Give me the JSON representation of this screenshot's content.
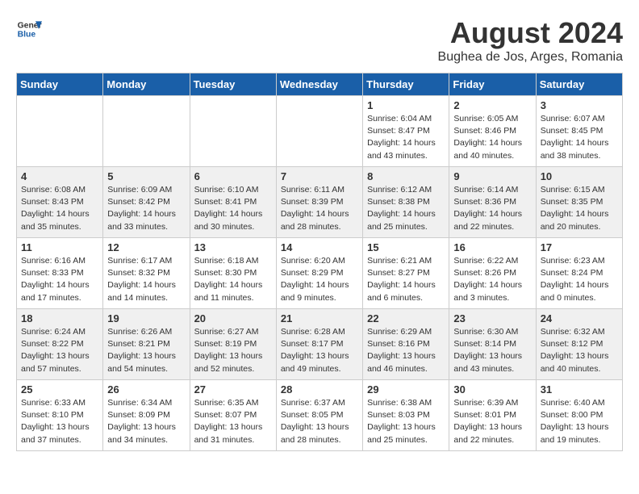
{
  "header": {
    "logo_line1": "General",
    "logo_line2": "Blue",
    "month_year": "August 2024",
    "location": "Bughea de Jos, Arges, Romania"
  },
  "weekdays": [
    "Sunday",
    "Monday",
    "Tuesday",
    "Wednesday",
    "Thursday",
    "Friday",
    "Saturday"
  ],
  "weeks": [
    [
      {
        "day": "",
        "info": ""
      },
      {
        "day": "",
        "info": ""
      },
      {
        "day": "",
        "info": ""
      },
      {
        "day": "",
        "info": ""
      },
      {
        "day": "1",
        "info": "Sunrise: 6:04 AM\nSunset: 8:47 PM\nDaylight: 14 hours\nand 43 minutes."
      },
      {
        "day": "2",
        "info": "Sunrise: 6:05 AM\nSunset: 8:46 PM\nDaylight: 14 hours\nand 40 minutes."
      },
      {
        "day": "3",
        "info": "Sunrise: 6:07 AM\nSunset: 8:45 PM\nDaylight: 14 hours\nand 38 minutes."
      }
    ],
    [
      {
        "day": "4",
        "info": "Sunrise: 6:08 AM\nSunset: 8:43 PM\nDaylight: 14 hours\nand 35 minutes."
      },
      {
        "day": "5",
        "info": "Sunrise: 6:09 AM\nSunset: 8:42 PM\nDaylight: 14 hours\nand 33 minutes."
      },
      {
        "day": "6",
        "info": "Sunrise: 6:10 AM\nSunset: 8:41 PM\nDaylight: 14 hours\nand 30 minutes."
      },
      {
        "day": "7",
        "info": "Sunrise: 6:11 AM\nSunset: 8:39 PM\nDaylight: 14 hours\nand 28 minutes."
      },
      {
        "day": "8",
        "info": "Sunrise: 6:12 AM\nSunset: 8:38 PM\nDaylight: 14 hours\nand 25 minutes."
      },
      {
        "day": "9",
        "info": "Sunrise: 6:14 AM\nSunset: 8:36 PM\nDaylight: 14 hours\nand 22 minutes."
      },
      {
        "day": "10",
        "info": "Sunrise: 6:15 AM\nSunset: 8:35 PM\nDaylight: 14 hours\nand 20 minutes."
      }
    ],
    [
      {
        "day": "11",
        "info": "Sunrise: 6:16 AM\nSunset: 8:33 PM\nDaylight: 14 hours\nand 17 minutes."
      },
      {
        "day": "12",
        "info": "Sunrise: 6:17 AM\nSunset: 8:32 PM\nDaylight: 14 hours\nand 14 minutes."
      },
      {
        "day": "13",
        "info": "Sunrise: 6:18 AM\nSunset: 8:30 PM\nDaylight: 14 hours\nand 11 minutes."
      },
      {
        "day": "14",
        "info": "Sunrise: 6:20 AM\nSunset: 8:29 PM\nDaylight: 14 hours\nand 9 minutes."
      },
      {
        "day": "15",
        "info": "Sunrise: 6:21 AM\nSunset: 8:27 PM\nDaylight: 14 hours\nand 6 minutes."
      },
      {
        "day": "16",
        "info": "Sunrise: 6:22 AM\nSunset: 8:26 PM\nDaylight: 14 hours\nand 3 minutes."
      },
      {
        "day": "17",
        "info": "Sunrise: 6:23 AM\nSunset: 8:24 PM\nDaylight: 14 hours\nand 0 minutes."
      }
    ],
    [
      {
        "day": "18",
        "info": "Sunrise: 6:24 AM\nSunset: 8:22 PM\nDaylight: 13 hours\nand 57 minutes."
      },
      {
        "day": "19",
        "info": "Sunrise: 6:26 AM\nSunset: 8:21 PM\nDaylight: 13 hours\nand 54 minutes."
      },
      {
        "day": "20",
        "info": "Sunrise: 6:27 AM\nSunset: 8:19 PM\nDaylight: 13 hours\nand 52 minutes."
      },
      {
        "day": "21",
        "info": "Sunrise: 6:28 AM\nSunset: 8:17 PM\nDaylight: 13 hours\nand 49 minutes."
      },
      {
        "day": "22",
        "info": "Sunrise: 6:29 AM\nSunset: 8:16 PM\nDaylight: 13 hours\nand 46 minutes."
      },
      {
        "day": "23",
        "info": "Sunrise: 6:30 AM\nSunset: 8:14 PM\nDaylight: 13 hours\nand 43 minutes."
      },
      {
        "day": "24",
        "info": "Sunrise: 6:32 AM\nSunset: 8:12 PM\nDaylight: 13 hours\nand 40 minutes."
      }
    ],
    [
      {
        "day": "25",
        "info": "Sunrise: 6:33 AM\nSunset: 8:10 PM\nDaylight: 13 hours\nand 37 minutes."
      },
      {
        "day": "26",
        "info": "Sunrise: 6:34 AM\nSunset: 8:09 PM\nDaylight: 13 hours\nand 34 minutes."
      },
      {
        "day": "27",
        "info": "Sunrise: 6:35 AM\nSunset: 8:07 PM\nDaylight: 13 hours\nand 31 minutes."
      },
      {
        "day": "28",
        "info": "Sunrise: 6:37 AM\nSunset: 8:05 PM\nDaylight: 13 hours\nand 28 minutes."
      },
      {
        "day": "29",
        "info": "Sunrise: 6:38 AM\nSunset: 8:03 PM\nDaylight: 13 hours\nand 25 minutes."
      },
      {
        "day": "30",
        "info": "Sunrise: 6:39 AM\nSunset: 8:01 PM\nDaylight: 13 hours\nand 22 minutes."
      },
      {
        "day": "31",
        "info": "Sunrise: 6:40 AM\nSunset: 8:00 PM\nDaylight: 13 hours\nand 19 minutes."
      }
    ]
  ]
}
